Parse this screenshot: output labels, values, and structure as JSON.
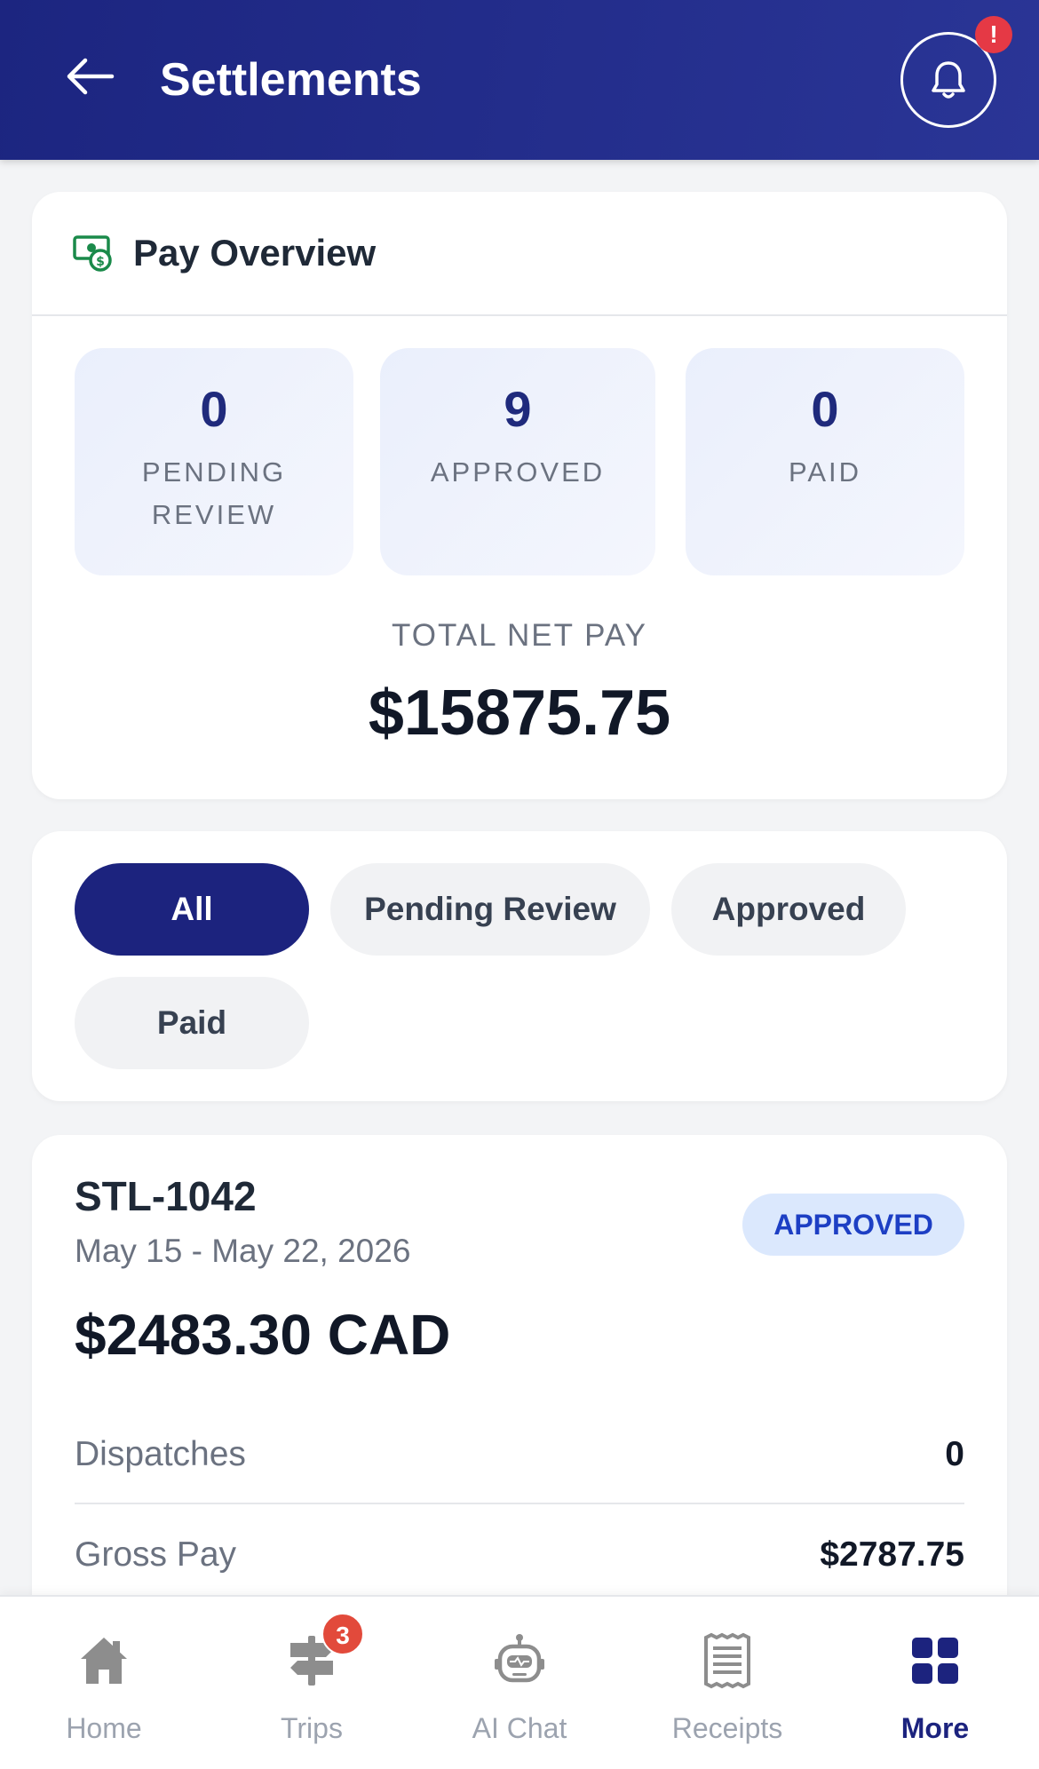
{
  "header": {
    "title": "Settlements",
    "alert_badge": "!"
  },
  "overview": {
    "title": "Pay Overview",
    "stats": [
      {
        "value": "0",
        "label": "PENDING REVIEW"
      },
      {
        "value": "9",
        "label": "APPROVED"
      },
      {
        "value": "0",
        "label": "PAID"
      }
    ],
    "net_pay_label": "TOTAL NET PAY",
    "net_pay_value": "$15875.75"
  },
  "filters": {
    "chips": [
      "All",
      "Pending Review",
      "Approved",
      "Paid"
    ],
    "active": "All"
  },
  "settlement": {
    "id": "STL-1042",
    "dates": "May 15 - May 22, 2026",
    "amount": "$2483.30 CAD",
    "status": "APPROVED",
    "rows": [
      {
        "label": "Dispatches",
        "value": "0"
      },
      {
        "label": "Gross Pay",
        "value": "$2787.75"
      }
    ]
  },
  "nav": {
    "items": [
      {
        "label": "Home",
        "icon": "home-icon"
      },
      {
        "label": "Trips",
        "icon": "signpost-icon",
        "badge": "3"
      },
      {
        "label": "AI Chat",
        "icon": "robot-icon"
      },
      {
        "label": "Receipts",
        "icon": "receipt-icon"
      },
      {
        "label": "More",
        "icon": "grid-icon",
        "active": true
      }
    ]
  },
  "colors": {
    "header": "#1c2580",
    "accent": "#1c237e",
    "status_badge_bg": "#dbe8fd",
    "status_badge_text": "#1d3fc4",
    "alert": "#e53945",
    "money_icon": "#1a8a4a"
  }
}
